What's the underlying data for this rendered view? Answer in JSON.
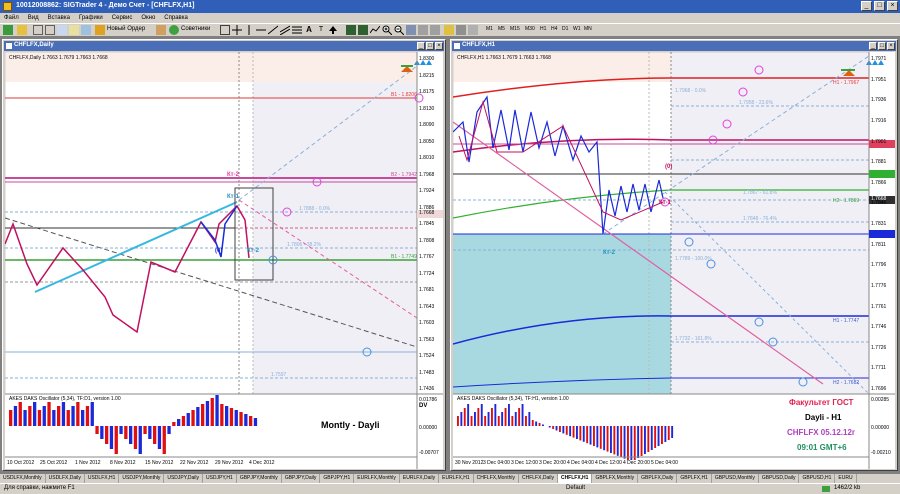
{
  "app": {
    "title": "10012008862: SIGTrader 4 - Демо Счет - [CHFLFX,H1]",
    "colors": {
      "titlebar": "#2f5fb8",
      "chart_bg": "#ffffff",
      "bull": "#1a2ad8",
      "bear": "#e01010"
    }
  },
  "window_buttons": [
    "_",
    "□",
    "×"
  ],
  "menu": [
    "Файл",
    "Вид",
    "Вставка",
    "Графики",
    "Сервис",
    "Окно",
    "Справка"
  ],
  "toolbar": {
    "new_order": "Новый Ордер",
    "advisors": "Советники",
    "timeframes": [
      "M1",
      "M5",
      "M15",
      "M30",
      "H1",
      "H4",
      "D1",
      "W1",
      "MN"
    ]
  },
  "left_chart": {
    "window_title": "CHFLFX,Daily",
    "info": "CHFLFX,Daily  1.7663 1.7679 1.7663 1.7668",
    "price_ticks": [
      "1.8300",
      "1.8215",
      "1.8175",
      "1.8130",
      "1.8090",
      "1.8050",
      "1.8010",
      "1.7968",
      "1.7924",
      "1.7886",
      "1.7845",
      "1.7808",
      "1.7767",
      "1.7724",
      "1.7681",
      "1.7643",
      "1.7603",
      "1.7563",
      "1.7524",
      "1.7483",
      "1.7436"
    ],
    "date_ticks": [
      "10 Oct 2012",
      "25 Oct 2012",
      "1 Nov 2012",
      "8 Nov 2012",
      "15 Nov 2012",
      "22 Nov 2012",
      "29 Nov 2012",
      "4 Dec 2012"
    ],
    "levels": [
      {
        "text": "B1 - 1.8206",
        "color": "#e23a3a"
      },
      {
        "text": "B2 - 1.7942",
        "color": "#c84a9a"
      },
      {
        "text": "B1 - 1.7749",
        "color": "#3aa03a"
      },
      {
        "text": "1.7888 - 0.0%",
        "color": "#8ab0d8"
      },
      {
        "text": "1.7806 - 38.2%",
        "color": "#8ab0d8"
      },
      {
        "text": "1.7597",
        "color": "#8ab0d8"
      }
    ],
    "labels": {
      "kt1": "Кт-1",
      "kt2": "Кт-2",
      "kt2b": "Кт-2",
      "zero": "(0)"
    },
    "price_marker": "1.7668",
    "oscillator": "AKES DAKS Oscillator (5,34), TF:D1, version 1.00",
    "osc_ticks": [
      "0.01786",
      "0.00000",
      "-0.00707"
    ],
    "note": "Montly - Dayli",
    "dv": "DV"
  },
  "right_chart": {
    "window_title": "CHFLFX,H1",
    "info": "CHFLFX,H1  1.7663 1.7679 1.7663 1.7668",
    "price_ticks": [
      "1.7971",
      "1.7951",
      "1.7936",
      "1.7916",
      "1.7901",
      "1.7881",
      "1.7866",
      "1.7846",
      "1.7831",
      "1.7811",
      "1.7796",
      "1.7776",
      "1.7761",
      "1.7746",
      "1.7726",
      "1.7711",
      "1.7696"
    ],
    "date_ticks": [
      "30 Nov 2012",
      "3 Dec 04:00",
      "3 Dec 12:00",
      "3 Dec 20:00",
      "4 Dec 04:00",
      "4 Dec 12:00",
      "4 Dec 20:00",
      "5 Dec 04:00"
    ],
    "levels": [
      {
        "text": "H1 - 1.7967",
        "color": "#e23a3a"
      },
      {
        "text": "H2 - 1.7869",
        "color": "#3aa03a"
      },
      {
        "text": "H1 - 1.7747",
        "color": "#3a58c8"
      },
      {
        "text": "H2 - 1.7682",
        "color": "#3a58c8"
      },
      {
        "text": "1.7968 - 0.0%",
        "color": "#8ab0d8"
      },
      {
        "text": "1.7958 - 23.6%",
        "color": "#8ab0d8"
      },
      {
        "text": "1.7867 - 61.8%",
        "color": "#8ab0d8"
      },
      {
        "text": "1.7848 - 76.4%",
        "color": "#8ab0d8"
      },
      {
        "text": "1.7789 - 100.0%",
        "color": "#8ab0d8"
      },
      {
        "text": "1.7732 - 161.8%",
        "color": "#8ab0d8"
      }
    ],
    "labels": {
      "kt1": "Кт-1",
      "kt2": "Кт-2",
      "zero": "(0)"
    },
    "price_marker": "1.7668",
    "oscillator": "AKES DAKS Oscillator (5,34), TF:H1, version 1.00",
    "osc_ticks": [
      "0.00285",
      "0.00000",
      "-0.00210"
    ],
    "annotations": {
      "faculty": "Факультет ГОСТ",
      "timeframe": "Dayli - H1",
      "symbol_date": "CHFLFX 05.12.12г",
      "time": "09:01 GMT+6"
    }
  },
  "tabs": [
    "USDLFX,Monthly",
    "USDLFX,Daily",
    "USDLFX,H1",
    "USDJPY,Monthly",
    "USDJPY,Daily",
    "USDJPY,H1",
    "GBPJPY,Monthly",
    "GBPJPY,Daily",
    "GBPJPY,H1",
    "EURLFX,Monthly",
    "EURLFX,Daily",
    "EURLFX,H1",
    "CHFLFX,Monthly",
    "CHFLFX,Daily",
    "CHFLFX,H1",
    "GBPLFX,Monthly",
    "GBPLFX,Daily",
    "GBPLFX,H1",
    "GBPUSD,Monthly",
    "GBPUSD,Daily",
    "GBPUSD,H1",
    "EURU"
  ],
  "active_tab": "CHFLFX,H1",
  "status": {
    "help": "Для справки, нажмите F1",
    "profile": "Default",
    "traffic": "1462/2 kb"
  }
}
